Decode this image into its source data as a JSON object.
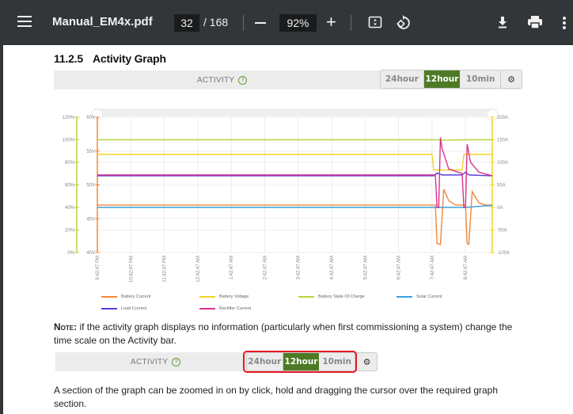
{
  "toolbar": {
    "menu_icon": "hamburger-menu-icon",
    "title": "Manual_EM4x.pdf",
    "current_page": "32",
    "page_total": "/ 168",
    "zoom_level": "92%",
    "zoom_out_icon": "minus-icon",
    "zoom_in_icon": "plus-icon",
    "fit_icon": "fit-to-page-icon",
    "rotate_icon": "rotate-icon",
    "download_icon": "download-icon",
    "print_icon": "print-icon",
    "more_icon": "more-vert-icon"
  },
  "document": {
    "section_number": "11.2.5",
    "section_title": "Activity Graph",
    "activity_bar": {
      "label": "ACTIVITY",
      "help_icon": "?",
      "buttons": [
        "24hour",
        "12hour",
        "10min"
      ],
      "selected": "12hour",
      "settings_icon": "⚙"
    },
    "note_label": "Note:",
    "note_text": " if the activity graph displays no information (particularly when first commissioning a system) change the time scale on the Activity bar.",
    "activity_bar_2": {
      "label": "ACTIVITY",
      "help_icon": "?",
      "buttons": [
        "24hour",
        "12hour",
        "10min"
      ],
      "selected": "12hour",
      "settings_icon": "⚙"
    },
    "paragraph": "A section of the graph can be zoomed in on by click, hold and dragging the cursor over the required graph section."
  },
  "colors": {
    "toolbar_bg": "#323639",
    "active_button": "#4e7a26",
    "highlight": "#e31b23",
    "battery_current": "#f0883a",
    "battery_voltage": "#f2d32a",
    "battery_soc": "#b5d63a",
    "solar_current": "#3aa0d8",
    "load_current": "#5a3ad8",
    "rectifier_current": "#d8338a"
  },
  "chart_data": {
    "type": "line",
    "title": "",
    "x": [
      "9:42:47 PM",
      "10:42:47 PM",
      "11:42:47 PM",
      "12:42:47 AM",
      "1:42:47 AM",
      "2:42:47 AM",
      "3:42:47 AM",
      "4:42:47 AM",
      "5:42:47 AM",
      "6:42:47 AM",
      "7:42:47 AM",
      "8:42:47 AM"
    ],
    "x_hours_range": [
      0,
      11.8
    ],
    "axes": {
      "percent": {
        "ticks": [
          "0%",
          "20%",
          "40%",
          "60%",
          "80%",
          "100%",
          "120%"
        ],
        "range": [
          0,
          120
        ]
      },
      "voltage": {
        "ticks": [
          "40V",
          "45V",
          "50V",
          "55V",
          "60V"
        ],
        "range": [
          40,
          60
        ]
      },
      "current": {
        "ticks": [
          "-100A",
          "-50A",
          "0A",
          "50A",
          "100A",
          "150A",
          "200A"
        ],
        "range": [
          -100,
          200
        ]
      }
    },
    "grid": true,
    "legend_position": "bottom",
    "series": [
      {
        "name": "Battery Current",
        "axis": "current",
        "color": "#f0883a",
        "points": [
          [
            0,
            5
          ],
          [
            10.1,
            5
          ],
          [
            10.15,
            -80
          ],
          [
            10.25,
            -82
          ],
          [
            10.35,
            40
          ],
          [
            10.5,
            15
          ],
          [
            10.7,
            5
          ],
          [
            11.0,
            5
          ],
          [
            11.05,
            -80
          ],
          [
            11.1,
            -82
          ],
          [
            11.2,
            35
          ],
          [
            11.4,
            10
          ],
          [
            11.6,
            5
          ],
          [
            11.8,
            5
          ]
        ]
      },
      {
        "name": "Battery Voltage",
        "axis": "voltage",
        "color": "#f2d32a",
        "points": [
          [
            0,
            54.5
          ],
          [
            10.0,
            54.5
          ],
          [
            10.05,
            52.2
          ],
          [
            10.9,
            52.2
          ],
          [
            10.95,
            54.5
          ],
          [
            11.8,
            54.5
          ]
        ]
      },
      {
        "name": "Battery State Of Charge",
        "axis": "percent",
        "color": "#b5d63a",
        "points": [
          [
            0,
            100
          ],
          [
            10.2,
            100
          ],
          [
            10.3,
            99.5
          ],
          [
            11.0,
            100
          ],
          [
            11.8,
            100
          ]
        ]
      },
      {
        "name": "Solar Current",
        "axis": "current",
        "color": "#3aa0d8",
        "points": [
          [
            0,
            0
          ],
          [
            11.0,
            0
          ],
          [
            11.3,
            2
          ],
          [
            11.5,
            3
          ],
          [
            11.8,
            4
          ]
        ]
      },
      {
        "name": "Load Current",
        "axis": "current",
        "color": "#5a3ad8",
        "points": [
          [
            0,
            70
          ],
          [
            10.05,
            70
          ],
          [
            10.15,
            76
          ],
          [
            10.3,
            72
          ],
          [
            10.9,
            72
          ],
          [
            11.0,
            78
          ],
          [
            11.1,
            72
          ],
          [
            11.8,
            70
          ]
        ]
      },
      {
        "name": "Rectifier Current",
        "axis": "current",
        "color": "#d8338a",
        "points": [
          [
            0,
            72
          ],
          [
            10.1,
            72
          ],
          [
            10.15,
            0
          ],
          [
            10.2,
            0
          ],
          [
            10.25,
            155
          ],
          [
            10.3,
            130
          ],
          [
            10.5,
            85
          ],
          [
            10.9,
            75
          ],
          [
            10.95,
            0
          ],
          [
            11.0,
            0
          ],
          [
            11.05,
            140
          ],
          [
            11.15,
            100
          ],
          [
            11.4,
            78
          ],
          [
            11.8,
            70
          ]
        ]
      }
    ]
  }
}
